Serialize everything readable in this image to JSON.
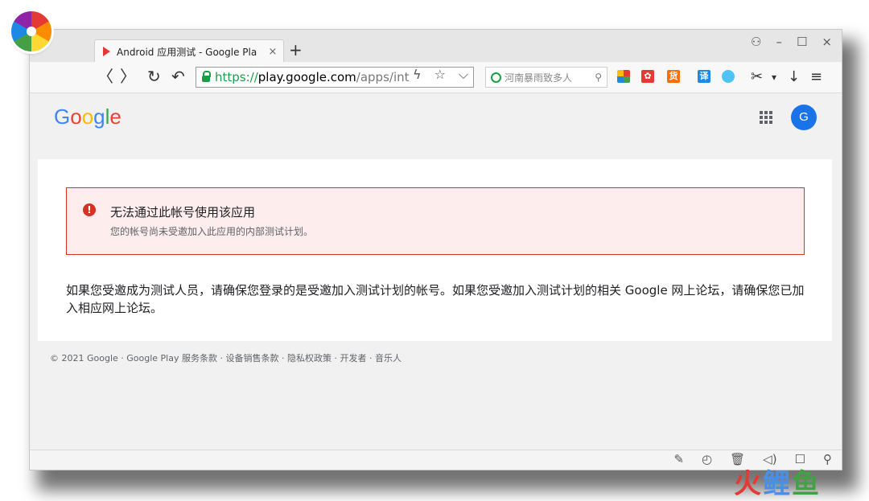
{
  "browser": {
    "tab": {
      "title": "Android 应用测试 - Google Pla",
      "close": "×"
    },
    "new_tab": "+",
    "window_controls": {
      "skin": "⚇",
      "minimize": "–",
      "maximize": "☐",
      "close": "×"
    },
    "nav": {
      "back": "〈",
      "forward": "〉",
      "reload": "↻",
      "undo": "↶"
    },
    "address": {
      "scheme": "https://",
      "host": "play.google.com",
      "path": "/apps/int"
    },
    "address_icons": {
      "bolt": "ϟ",
      "star": "☆",
      "dropdown": "⌵"
    },
    "search": {
      "text": "河南暴雨致多人",
      "icon": "⚲"
    },
    "extensions": [
      {
        "name": "apps-grid-icon",
        "text": "",
        "color": "#f4b400"
      },
      {
        "name": "game-icon",
        "text": "✿",
        "color": "#e53935"
      },
      {
        "name": "shopping-icon",
        "text": "货",
        "color": "#ff6d00"
      },
      {
        "name": "translate-icon",
        "text": "译",
        "color": "#1e88e5"
      },
      {
        "name": "cloud-icon",
        "text": "",
        "color": "#4fc3f7"
      }
    ],
    "toolbar_right": {
      "cut": "✂",
      "more": "▾",
      "download": "↓",
      "menu": "≡"
    }
  },
  "page": {
    "google_logo": [
      {
        "char": "G",
        "color": "#4285f4"
      },
      {
        "char": "o",
        "color": "#ea4335"
      },
      {
        "char": "o",
        "color": "#fbbc05"
      },
      {
        "char": "g",
        "color": "#4285f4"
      },
      {
        "char": "l",
        "color": "#34a853"
      },
      {
        "char": "e",
        "color": "#ea4335"
      }
    ],
    "avatar_letter": "G",
    "alert": {
      "icon": "!",
      "title": "无法通过此帐号使用该应用",
      "subtitle": "您的帐号尚未受邀加入此应用的内部测试计划。"
    },
    "body": "如果您受邀成为测试人员，请确保您登录的是受邀加入测试计划的帐号。如果您受邀加入测试计划的相关 Google 网上论坛，请确保您已加入相应网上论坛。",
    "footer": "© 2021 Google · Google Play 服务条款 · 设备销售条款 · 隐私权政策 · 开发者 · 音乐人"
  },
  "statusbar": {
    "icons": [
      "✎",
      "◴",
      "🗑",
      "◁)",
      "☐",
      "⚲"
    ]
  },
  "watermark": {
    "part1": "火",
    "part2": "鲤",
    "part3": "鱼"
  },
  "colors": {
    "accent_red": "#d93025",
    "alert_bg": "#fdeded",
    "url_green": "#1a9e44",
    "avatar_blue": "#1a73e8"
  }
}
